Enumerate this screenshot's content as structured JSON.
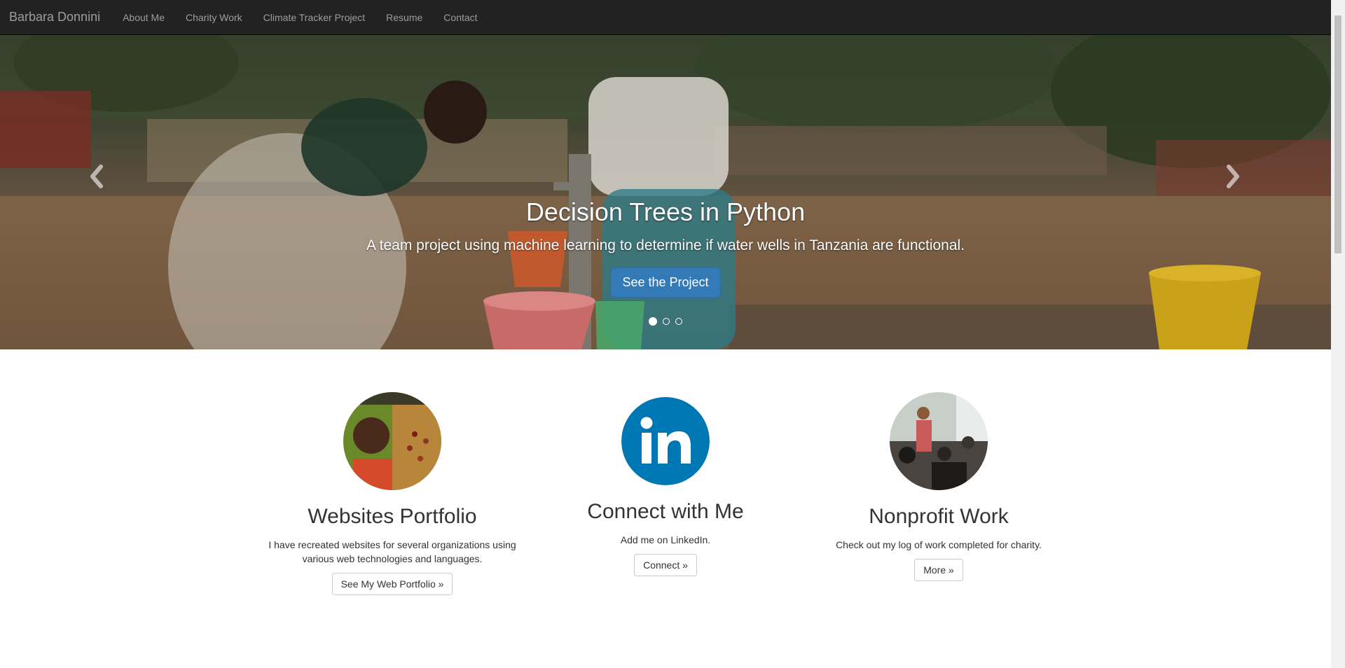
{
  "navbar": {
    "brand": "Barbara Donnini",
    "items": [
      {
        "label": "About Me"
      },
      {
        "label": "Charity Work"
      },
      {
        "label": "Climate Tracker Project"
      },
      {
        "label": "Resume"
      },
      {
        "label": "Contact"
      }
    ]
  },
  "hero": {
    "title": "Decision Trees in Python",
    "subtitle": "A team project using machine learning to determine if water wells in Tanzania are functional.",
    "button_label": "See the Project",
    "prev_icon": "chevron-left-icon",
    "next_icon": "chevron-right-icon",
    "slide_count": 3,
    "active_slide": 1
  },
  "features": [
    {
      "title": "Websites Portfolio",
      "text": "I have recreated websites for several organizations using various web technologies and languages.",
      "button": "See My Web Portfolio »",
      "image": "coffee-farmer-photo"
    },
    {
      "title": "Connect with Me",
      "text": "Add me on LinkedIn.",
      "button": "Connect »",
      "image": "linkedin-icon",
      "color": "#0077b5"
    },
    {
      "title": "Nonprofit Work",
      "text": "Check out my log of work completed for charity.",
      "button": "More »",
      "image": "meeting-photo"
    }
  ],
  "colors": {
    "navbar": "#222222",
    "nav_text": "#9d9d9d",
    "primary_button": "#337ab7",
    "linkedin": "#0077b5"
  }
}
